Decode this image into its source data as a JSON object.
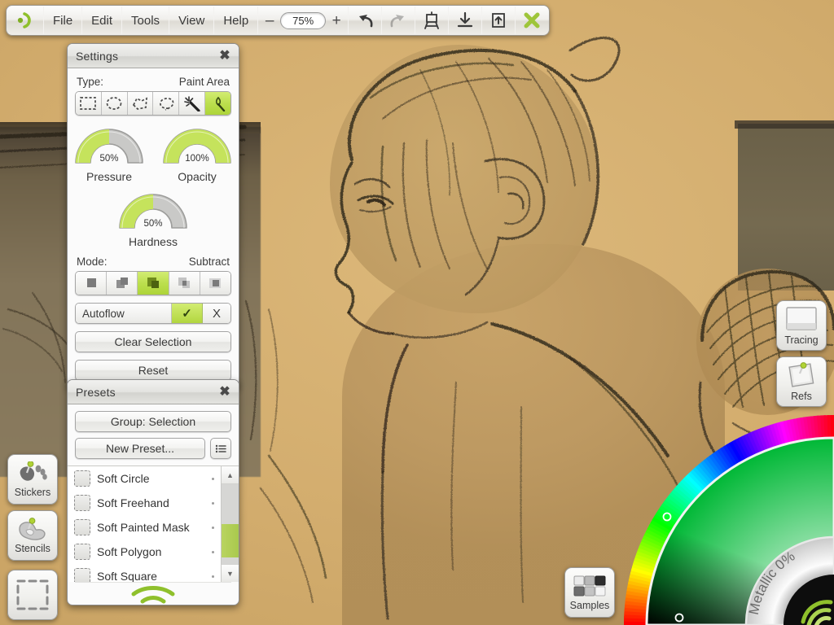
{
  "app": {
    "logo_icon": "artrage-logo-icon",
    "canvas_title": "digital-sketch-portrait"
  },
  "toolbar": {
    "menus": [
      "File",
      "Edit",
      "Tools",
      "View",
      "Help"
    ],
    "zoom": {
      "minus": "–",
      "value": "75%",
      "plus": "+"
    },
    "icons": [
      {
        "name": "undo-icon",
        "glyph": "undo",
        "enabled": true
      },
      {
        "name": "redo-icon",
        "glyph": "redo",
        "enabled": false
      },
      {
        "name": "easel-icon",
        "glyph": "easel",
        "enabled": true
      },
      {
        "name": "import-icon",
        "glyph": "import",
        "enabled": true
      },
      {
        "name": "export-icon",
        "glyph": "export",
        "enabled": true
      },
      {
        "name": "close-icon",
        "glyph": "close-x",
        "enabled": true
      }
    ]
  },
  "settings_panel": {
    "title": "Settings",
    "close_label": "✖",
    "type_label": "Type:",
    "type_value": "Paint Area",
    "type_tools": [
      {
        "name": "rect-select-icon",
        "selected": false
      },
      {
        "name": "ellipse-select-icon",
        "selected": false
      },
      {
        "name": "polygon-select-icon",
        "selected": false
      },
      {
        "name": "lasso-select-icon",
        "selected": false
      },
      {
        "name": "magic-wand-icon",
        "selected": false
      },
      {
        "name": "paint-area-icon",
        "selected": true
      }
    ],
    "gauges": [
      {
        "name": "Pressure",
        "value": 50,
        "display": "50%"
      },
      {
        "name": "Opacity",
        "value": 100,
        "display": "100%"
      },
      {
        "name": "Hardness",
        "value": 50,
        "display": "50%"
      }
    ],
    "mode_label": "Mode:",
    "mode_value": "Subtract",
    "mode_tools": [
      {
        "name": "mode-replace-icon",
        "selected": false
      },
      {
        "name": "mode-add-icon",
        "selected": false
      },
      {
        "name": "mode-subtract-icon",
        "selected": true
      },
      {
        "name": "mode-intersect-icon",
        "selected": false
      },
      {
        "name": "mode-invert-icon",
        "selected": false
      }
    ],
    "autoflow": {
      "label": "Autoflow",
      "yes_label": "✓",
      "no_label": "X",
      "enabled": true
    },
    "clear_selection_label": "Clear Selection",
    "reset_label": "Reset"
  },
  "presets_panel": {
    "title": "Presets",
    "close_label": "✖",
    "group_label": "Group:  Selection",
    "new_preset_label": "New Preset...",
    "menu_icon": "list-menu-icon",
    "items": [
      {
        "label": "Soft Circle",
        "icon": "preset-thumb-icon"
      },
      {
        "label": "Soft Freehand",
        "icon": "preset-thumb-icon"
      },
      {
        "label": "Soft Painted Mask",
        "icon": "preset-thumb-icon"
      },
      {
        "label": "Soft Polygon",
        "icon": "preset-thumb-icon"
      },
      {
        "label": "Soft Square",
        "icon": "preset-thumb-icon"
      }
    ],
    "scroll_up_label": "▲",
    "scroll_down_label": "▼",
    "footer_icon": "artrage-arcs-icon"
  },
  "side_buttons": [
    {
      "name": "stickers-button",
      "label": "Stickers",
      "icon": "sticker-pin-icon"
    },
    {
      "name": "stencils-button",
      "label": "Stencils",
      "icon": "stencil-pin-icon"
    },
    {
      "name": "selection-button",
      "label": "",
      "icon": "dashed-selection-icon"
    }
  ],
  "right_buttons": [
    {
      "name": "tracing-button",
      "label": "Tracing",
      "icon": "tracing-page-icon"
    },
    {
      "name": "refs-button",
      "label": "Refs",
      "icon": "reference-pin-icon"
    }
  ],
  "samples_button": {
    "name": "samples-button",
    "label": "Samples",
    "icon": "swatch-grid-icon"
  },
  "color_picker": {
    "name": "color-picker-wheel",
    "metallic_label": "Metallic 0%",
    "metallic_value": 0,
    "selected_hue_deg": 110,
    "current_color": "#1a4d14",
    "logo_icon": "artrage-arcs-icon"
  },
  "colors": {
    "accent_green": "#b5d44e",
    "accent_green_light": "#d2ec72",
    "panel_bg": "#fbfbfb",
    "panel_border": "#8e8e8e",
    "text": "#3a3a3a",
    "canvas_paper": "#d6b272",
    "canvas_shadow": "#6d6047",
    "sketch_ink": "#2b241a"
  }
}
